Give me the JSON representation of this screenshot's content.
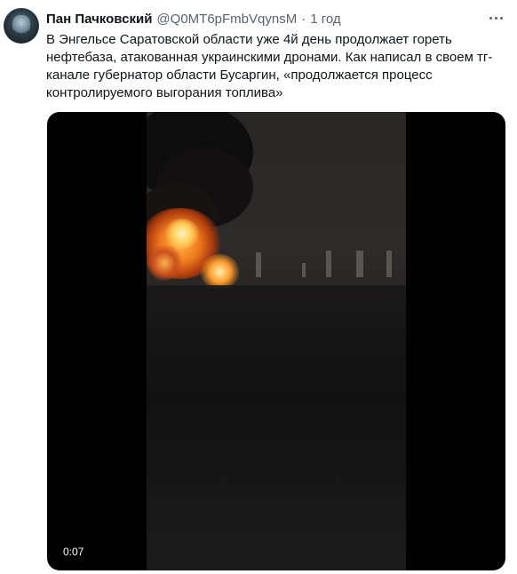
{
  "tweet": {
    "author_name": "Пан Пачковский",
    "author_handle": "@Q0MT6pFmbVqynsM",
    "separator": "·",
    "time": "1 год",
    "text_lines": [
      "В Энгельсе Саратовской области уже 4й день продолжает гореть",
      "нефтебаза, атакованная украинскими дронами. Как написал в своем тг-",
      "канале губернатор области Бусаргин, «продолжается процесс",
      "контролируемого выгорания топлива»"
    ]
  },
  "media": {
    "duration": "0:07"
  },
  "icons": {
    "more": "more-horizontal-icon"
  },
  "colors": {
    "text": "#0f1419",
    "secondary": "#536471",
    "media_bg": "#000000"
  }
}
